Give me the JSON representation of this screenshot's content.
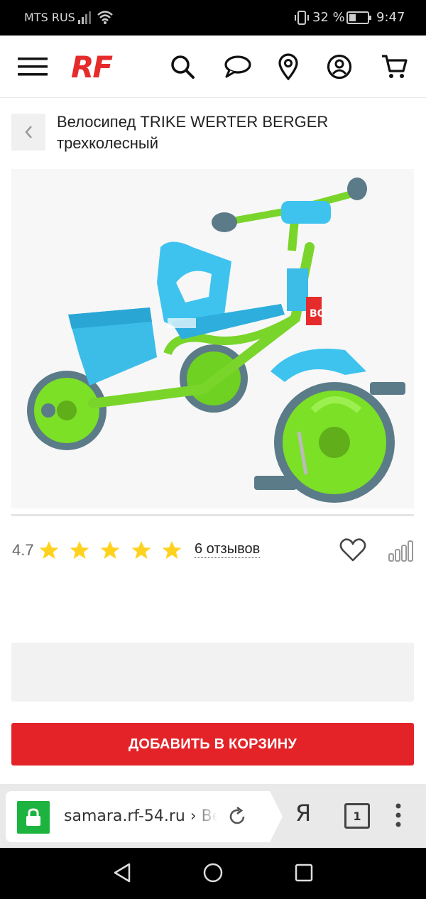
{
  "status_bar": {
    "carrier": "MTS RUS",
    "battery_percent": "32 %",
    "time": "9:47"
  },
  "header": {
    "logo": "RF",
    "icons": [
      "menu-icon",
      "search-icon",
      "chat-icon",
      "location-icon",
      "account-icon",
      "cart-icon"
    ]
  },
  "product": {
    "title": "Велосипед TRIKE WERTER BERGER трехколесный",
    "image_alt": "Велосипед TRIKE WERTER BERGER трехколесный",
    "rating": "4.7",
    "stars": 5,
    "reviews": "6 отзывов"
  },
  "actions": {
    "add_to_cart": "ДОБАВИТЬ В КОРЗИНУ"
  },
  "browser": {
    "url": "samara.rf-54.ru › Ве",
    "yandex": "Я",
    "tabs_count": "1"
  },
  "colors": {
    "brand_red": "#e52b2b",
    "button_red": "#e32328",
    "star_yellow": "#ffd21f",
    "secure_green": "#1db33f"
  }
}
